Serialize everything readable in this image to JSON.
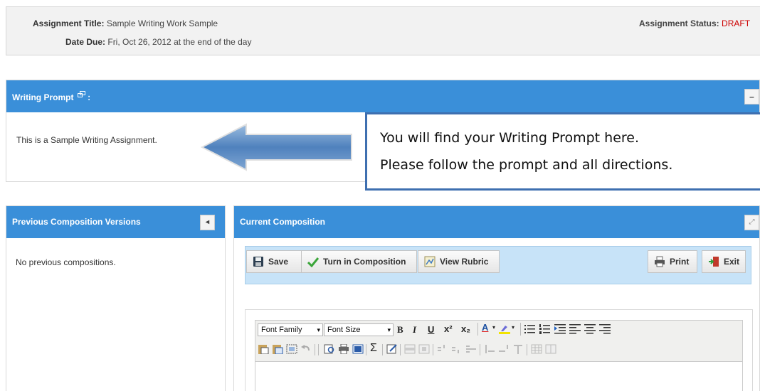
{
  "assignment": {
    "title_label": "Assignment Title:",
    "title_value": "Sample Writing Work Sample",
    "due_label": "Date Due:",
    "due_value": "Fri, Oct 26, 2012 at the end of the day",
    "status_label": "Assignment Status:",
    "status_value": "DRAFT"
  },
  "prompt_panel": {
    "title": "Writing Prompt",
    "colon": ":",
    "text": "This is a Sample Writing Assignment.",
    "collapse_label": "–"
  },
  "callout": {
    "line1": "You will find your Writing Prompt here.",
    "line2": "Please follow the prompt and all directions."
  },
  "previous_panel": {
    "title": "Previous Composition Versions",
    "empty_text": "No previous compositions.",
    "collapse_label": "◂"
  },
  "current_panel": {
    "title": "Current Composition",
    "expand_label": "⤢"
  },
  "toolbar": {
    "save_label": "Save",
    "turn_in_label": "Turn in Composition",
    "rubric_label": "View Rubric",
    "print_label": "Print",
    "exit_label": "Exit"
  },
  "editor": {
    "font_family": "Font Family",
    "font_size": "Font Size",
    "dropdown_arrow": "▾",
    "bold": "B",
    "italic": "I",
    "underline": "U",
    "superscript": "x²",
    "subscript": "x₂",
    "font_color": "A",
    "sigma": "Σ"
  },
  "colors": {
    "header_blue": "#3a8fd9",
    "status_red": "#cc0000",
    "callout_border": "#3e6fb0",
    "toolbar_bg": "#c7e3f8"
  }
}
